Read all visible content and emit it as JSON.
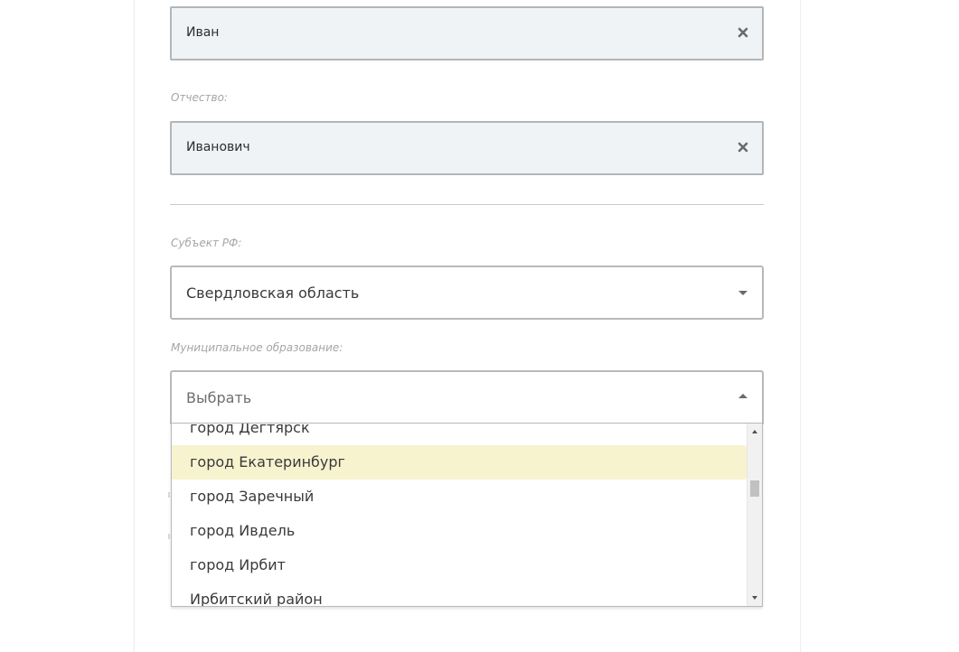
{
  "form": {
    "first_name": {
      "value": "Иван"
    },
    "patronymic": {
      "label": "Отчество:",
      "value": "Иванович"
    },
    "region": {
      "label": "Субъект РФ:",
      "value": "Свердловская область"
    },
    "municipality": {
      "label": "Муниципальное образование:",
      "placeholder": "Выбрать",
      "options": [
        "город Дегтярск",
        "город Екатеринбург",
        "город Заречный",
        "город Ивдель",
        "город Ирбит",
        "Ирбитский район"
      ],
      "highlighted_option": "город Екатеринбург"
    }
  },
  "icons": {
    "clear": "close-icon",
    "caret_down": "chevron-down-icon",
    "caret_up": "chevron-up-icon"
  },
  "colors": {
    "input_bg": "#eff3f6",
    "highlight": "#f8f3cf",
    "label": "#a3a6a9"
  }
}
